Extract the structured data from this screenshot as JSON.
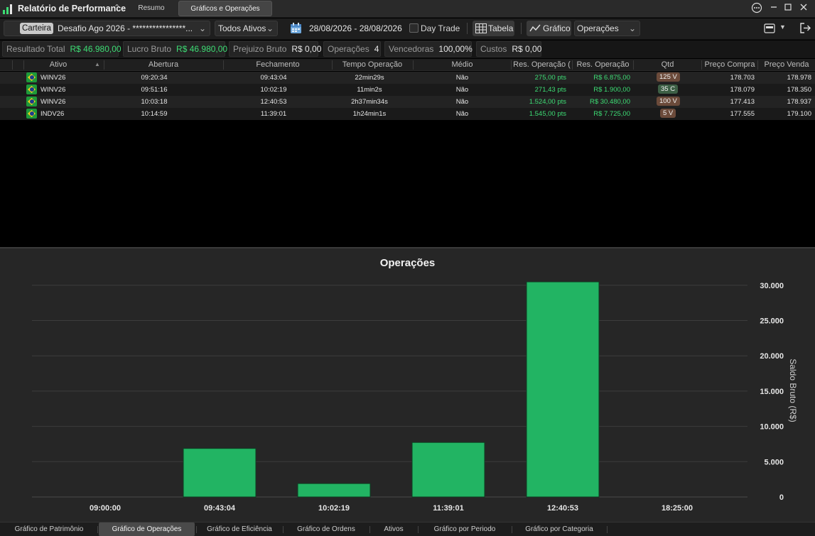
{
  "titlebar": {
    "app_title": "Relatório de Performance",
    "tabs": [
      "Resumo",
      "Gráficos e Operações"
    ],
    "active_tab": "Gráficos e Operações"
  },
  "toolbar": {
    "carteira_label": "Carteira",
    "account": "Desafio Ago 2026 - ****************...",
    "assets_filter": "Todos Ativos",
    "date_range": "28/08/2026 - 28/08/2026",
    "day_trade_label": "Day Trade",
    "day_trade_checked": false,
    "tabela_label": "Tabela",
    "grafico_label": "Gráfico",
    "chart_type": "Operações"
  },
  "summary": [
    {
      "label": "Resultado Total",
      "value": "R$ 46.980,00",
      "positive": true
    },
    {
      "label": "Lucro Bruto",
      "value": "R$ 46.980,00",
      "positive": true
    },
    {
      "label": "Prejuizo Bruto",
      "value": "R$ 0,00",
      "positive": false
    },
    {
      "label": "Operações",
      "value": "4",
      "positive": false
    },
    {
      "label": "Vencedoras",
      "value": "100,00%",
      "positive": false
    },
    {
      "label": "Custos",
      "value": "R$ 0,00",
      "positive": false
    }
  ],
  "table": {
    "columns": [
      "Ativo",
      "Abertura",
      "Fechamento",
      "Tempo Operação",
      "Médio",
      "Res. Operação (",
      "Res. Operação",
      "Qtd",
      "Preço Compra",
      "Preço Venda"
    ],
    "rows": [
      {
        "ativo": "WINV26",
        "abertura": "09:20:34",
        "fechamento": "09:43:04",
        "tempo": "22min29s",
        "medio": "Não",
        "res_pts": "275,00 pts",
        "res_rs": "R$ 6.875,00",
        "qtd": "125 V",
        "qtd_side": "v",
        "compra": "178.703",
        "venda": "178.978"
      },
      {
        "ativo": "WINV26",
        "abertura": "09:51:16",
        "fechamento": "10:02:19",
        "tempo": "11min2s",
        "medio": "Não",
        "res_pts": "271,43 pts",
        "res_rs": "R$ 1.900,00",
        "qtd": "35 C",
        "qtd_side": "c",
        "compra": "178.079",
        "venda": "178.350"
      },
      {
        "ativo": "WINV26",
        "abertura": "10:03:18",
        "fechamento": "12:40:53",
        "tempo": "2h37min34s",
        "medio": "Não",
        "res_pts": "1.524,00 pts",
        "res_rs": "R$ 30.480,00",
        "qtd": "100 V",
        "qtd_side": "v",
        "compra": "177.413",
        "venda": "178.937"
      },
      {
        "ativo": "INDV26",
        "abertura": "10:14:59",
        "fechamento": "11:39:01",
        "tempo": "1h24min1s",
        "medio": "Não",
        "res_pts": "1.545,00 pts",
        "res_rs": "R$ 7.725,00",
        "qtd": "5 V",
        "qtd_side": "v",
        "compra": "177.555",
        "venda": "179.100"
      }
    ]
  },
  "chart_data": {
    "type": "bar",
    "title": "Operações",
    "ylabel": "Saldo Bruto (R$)",
    "xlabel": "",
    "x_ticks": [
      "09:00:00",
      "09:43:04",
      "10:02:19",
      "11:39:01",
      "12:40:53",
      "18:25:00"
    ],
    "categories": [
      "09:43:04",
      "10:02:19",
      "11:39:01",
      "12:40:53"
    ],
    "values": [
      6875,
      1900,
      7725,
      30480
    ],
    "y_ticks": [
      "0",
      "5.000",
      "10.000",
      "15.000",
      "20.000",
      "25.000",
      "30.000"
    ],
    "ylim": [
      0,
      30480
    ],
    "grid": true,
    "bar_color": "#22b463"
  },
  "bottom_tabs": [
    "Gráfico de Patrimônio",
    "Gráfico de Operações",
    "Gráfico de Eficiência",
    "Gráfico de Ordens",
    "Ativos",
    "Gráfico por Periodo",
    "Gráfico por Categoria"
  ],
  "bottom_active": "Gráfico de Operações"
}
